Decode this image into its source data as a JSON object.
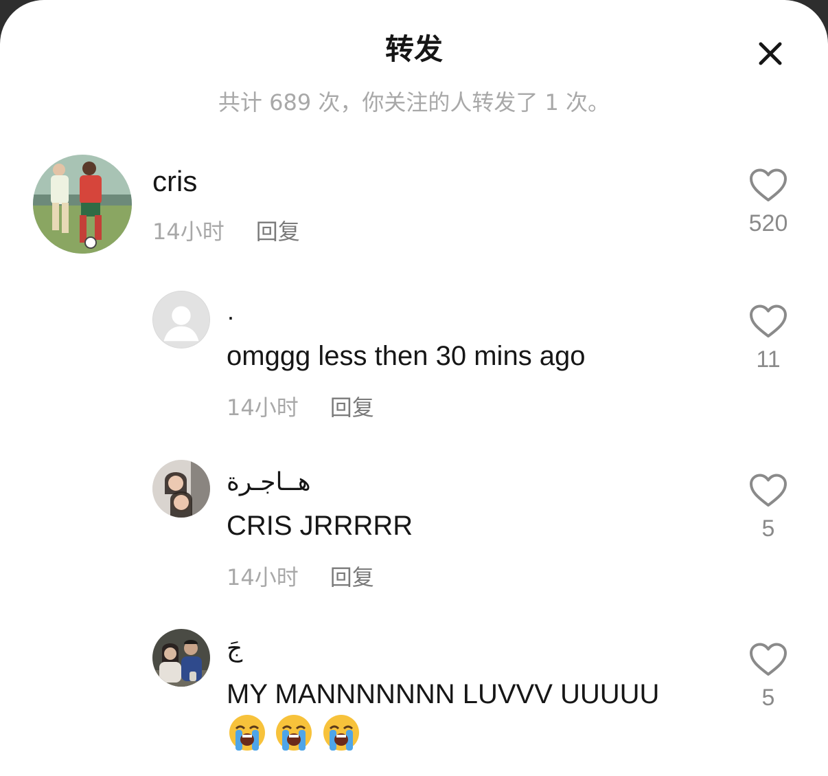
{
  "header": {
    "title": "转发",
    "subtitle": "共计 689 次，你关注的人转发了 1 次。"
  },
  "comments": [
    {
      "name": "cris",
      "time": "14小时",
      "reply": "回复",
      "likes": "520",
      "avatar": "soccer-players-photo"
    },
    {
      "name": "·",
      "text": "omggg less then 30 mins ago",
      "time": "14小时",
      "reply": "回复",
      "likes": "11",
      "avatar": "default-user-icon"
    },
    {
      "name": "هــاجـرة",
      "text": "CRIS JRRRRR",
      "time": "14小时",
      "reply": "回复",
      "likes": "5",
      "avatar": "two-girls-selfie-photo"
    },
    {
      "name": "جَ",
      "text": "MY MANNNNNNN LUVVV UUUUU",
      "emojis": [
        "loudly-crying-face",
        "loudly-crying-face",
        "loudly-crying-face"
      ],
      "likes": "5",
      "avatar": "couple-photo"
    }
  ],
  "colors": {
    "background": "#ffffff",
    "primary_text": "#161616",
    "secondary_text": "#a8a8a8",
    "reply_text": "#7a7a7a",
    "like_icon": "#8a8a8a"
  }
}
